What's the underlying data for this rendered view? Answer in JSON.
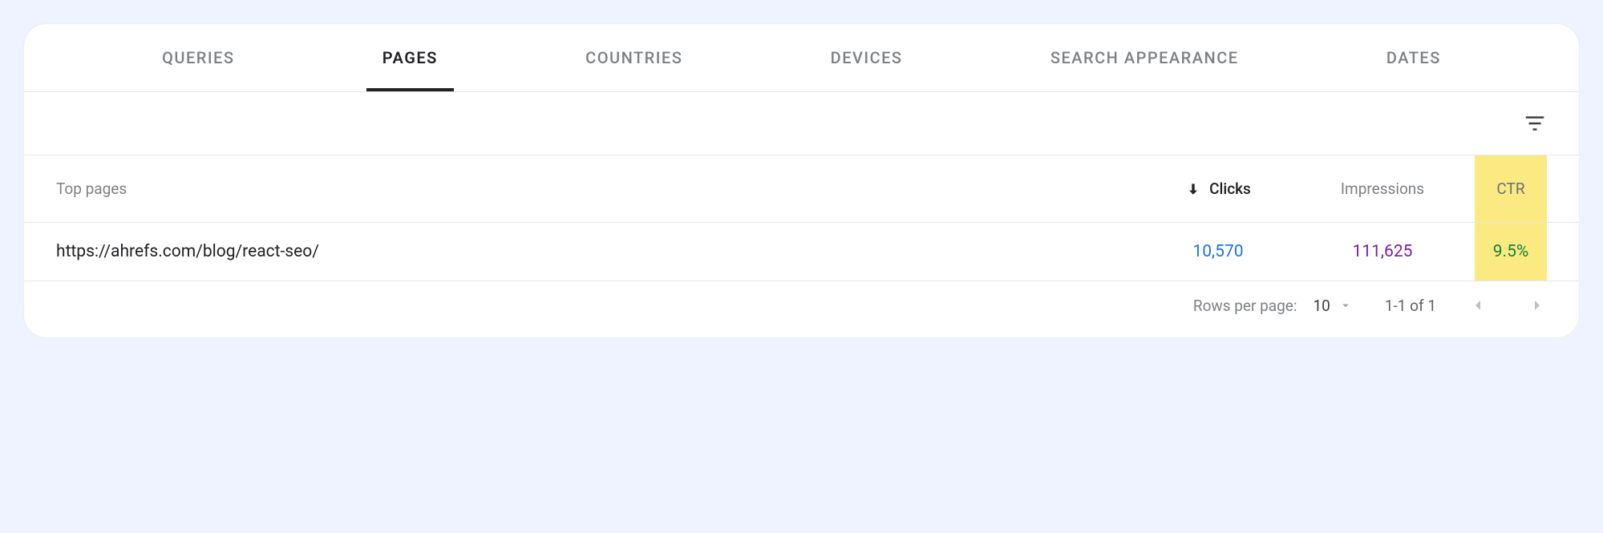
{
  "tabs": {
    "queries": "QUERIES",
    "pages": "PAGES",
    "countries": "COUNTRIES",
    "devices": "DEVICES",
    "search_appearance": "SEARCH APPEARANCE",
    "dates": "DATES",
    "active": "pages"
  },
  "table": {
    "headers": {
      "top_pages": "Top pages",
      "clicks": "Clicks",
      "impressions": "Impressions",
      "ctr": "CTR"
    },
    "rows": [
      {
        "page": "https://ahrefs.com/blog/react-seo/",
        "clicks": "10,570",
        "impressions": "111,625",
        "ctr": "9.5%"
      }
    ]
  },
  "pager": {
    "rows_per_page_label": "Rows per page:",
    "rows_per_page_value": "10",
    "range": "1-1 of 1"
  }
}
